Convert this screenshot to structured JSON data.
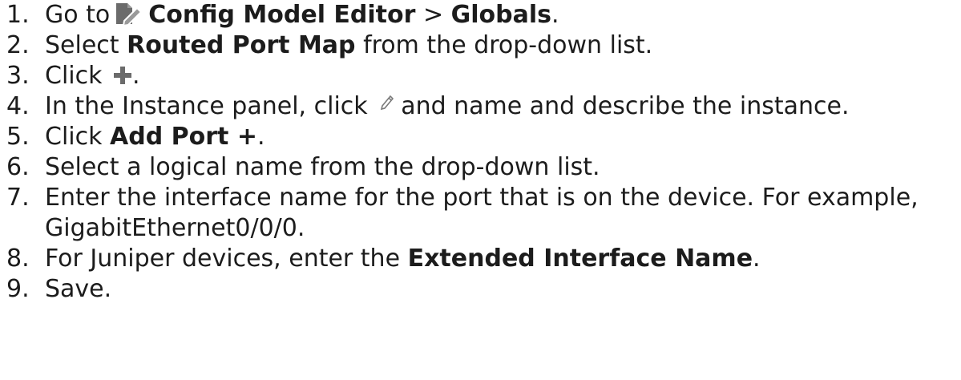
{
  "steps": [
    {
      "number": "1.",
      "prefix": "Go to",
      "bold": "Config Model Editor",
      "middle": " > ",
      "bold2": "Globals",
      "suffix": ".",
      "icon": "edit-document-icon"
    },
    {
      "number": "2.",
      "prefix": "Select ",
      "bold": "Routed Port Map",
      "suffix": " from the drop-down list."
    },
    {
      "number": "3.",
      "prefix": "Click ",
      "suffix": ".",
      "icon": "plus-icon"
    },
    {
      "number": "4.",
      "prefix": "In the Instance panel, click ",
      "suffix": "and name and describe the instance.",
      "icon": "pencil-icon"
    },
    {
      "number": "5.",
      "prefix": "Click ",
      "bold": "Add Port +",
      "suffix": "."
    },
    {
      "number": "6.",
      "text": "Select a logical name from the drop-down list."
    },
    {
      "number": "7.",
      "text": "Enter the interface name for the port that is on the device. For example, GigabitEthernet0/0/0."
    },
    {
      "number": "8.",
      "prefix": "For Juniper devices, enter the ",
      "bold": "Extended Interface Name",
      "suffix": "."
    },
    {
      "number": "9.",
      "text": "Save."
    }
  ],
  "colors": {
    "text": "#1c1c1c",
    "icon_gray": "#6b6b6b",
    "icon_tint": "#9a9a9a"
  }
}
